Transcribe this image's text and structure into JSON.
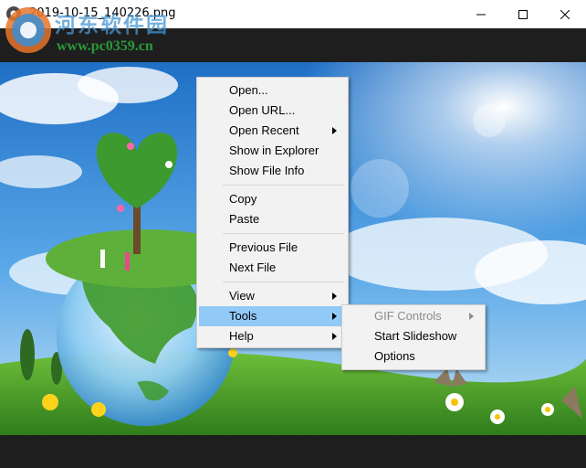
{
  "window": {
    "title": "2019-10-15_140226.png"
  },
  "watermark": {
    "title": "河东软件园",
    "url": "www.pc0359.cn"
  },
  "context_menu": {
    "items": [
      {
        "label": "Open..."
      },
      {
        "label": "Open URL..."
      },
      {
        "label": "Open Recent"
      },
      {
        "label": "Show in Explorer"
      },
      {
        "label": "Show File Info"
      },
      {
        "label": "Copy"
      },
      {
        "label": "Paste"
      },
      {
        "label": "Previous File"
      },
      {
        "label": "Next File"
      },
      {
        "label": "View"
      },
      {
        "label": "Tools"
      },
      {
        "label": "Help"
      }
    ],
    "highlighted": "Tools"
  },
  "tools_submenu": {
    "items": [
      {
        "label": "GIF Controls",
        "disabled": true
      },
      {
        "label": "Start Slideshow"
      },
      {
        "label": "Options"
      }
    ]
  },
  "colors": {
    "highlight": "#91c9f7",
    "menu_bg": "#f2f2f2",
    "chrome_dark": "#1e1e1e"
  }
}
